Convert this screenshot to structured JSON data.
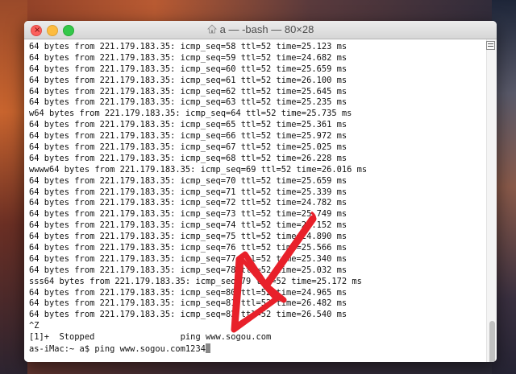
{
  "window": {
    "title": "a — -bash — 80×28"
  },
  "terminal": {
    "lines": [
      "64 bytes from 221.179.183.35: icmp_seq=58 ttl=52 time=25.123 ms",
      "64 bytes from 221.179.183.35: icmp_seq=59 ttl=52 time=24.682 ms",
      "64 bytes from 221.179.183.35: icmp_seq=60 ttl=52 time=25.659 ms",
      "64 bytes from 221.179.183.35: icmp_seq=61 ttl=52 time=26.100 ms",
      "64 bytes from 221.179.183.35: icmp_seq=62 ttl=52 time=25.645 ms",
      "64 bytes from 221.179.183.35: icmp_seq=63 ttl=52 time=25.235 ms",
      "w64 bytes from 221.179.183.35: icmp_seq=64 ttl=52 time=25.735 ms",
      "64 bytes from 221.179.183.35: icmp_seq=65 ttl=52 time=25.361 ms",
      "64 bytes from 221.179.183.35: icmp_seq=66 ttl=52 time=25.972 ms",
      "64 bytes from 221.179.183.35: icmp_seq=67 ttl=52 time=25.025 ms",
      "64 bytes from 221.179.183.35: icmp_seq=68 ttl=52 time=26.228 ms",
      "wwww64 bytes from 221.179.183.35: icmp_seq=69 ttl=52 time=26.016 ms",
      "64 bytes from 221.179.183.35: icmp_seq=70 ttl=52 time=25.659 ms",
      "64 bytes from 221.179.183.35: icmp_seq=71 ttl=52 time=25.339 ms",
      "64 bytes from 221.179.183.35: icmp_seq=72 ttl=52 time=24.782 ms",
      "64 bytes from 221.179.183.35: icmp_seq=73 ttl=52 time=25.749 ms",
      "64 bytes from 221.179.183.35: icmp_seq=74 ttl=52 time=26.152 ms",
      "64 bytes from 221.179.183.35: icmp_seq=75 ttl=52 time=24.890 ms",
      "64 bytes from 221.179.183.35: icmp_seq=76 ttl=52 time=25.566 ms",
      "64 bytes from 221.179.183.35: icmp_seq=77 ttl=52 time=25.340 ms",
      "64 bytes from 221.179.183.35: icmp_seq=78 ttl=52 time=25.032 ms",
      "sss64 bytes from 221.179.183.35: icmp_seq=79 ttl=52 time=25.172 ms",
      "64 bytes from 221.179.183.35: icmp_seq=80 ttl=52 time=24.965 ms",
      "64 bytes from 221.179.183.35: icmp_seq=81 ttl=52 time=26.482 ms",
      "64 bytes from 221.179.183.35: icmp_seq=82 ttl=52 time=26.540 ms",
      "^Z",
      "[1]+  Stopped                 ping www.sogou.com"
    ],
    "prompt_line": "as-iMac:~ a$ ping www.sogou.com1234"
  },
  "icons": {
    "window_title_icon": "home-folder-icon",
    "annotation": "red-arrow-annotation"
  },
  "colors": {
    "arrow": "#e8202a",
    "close": "#fc605c",
    "minimize": "#fdbc40",
    "maximize": "#34c84a"
  }
}
